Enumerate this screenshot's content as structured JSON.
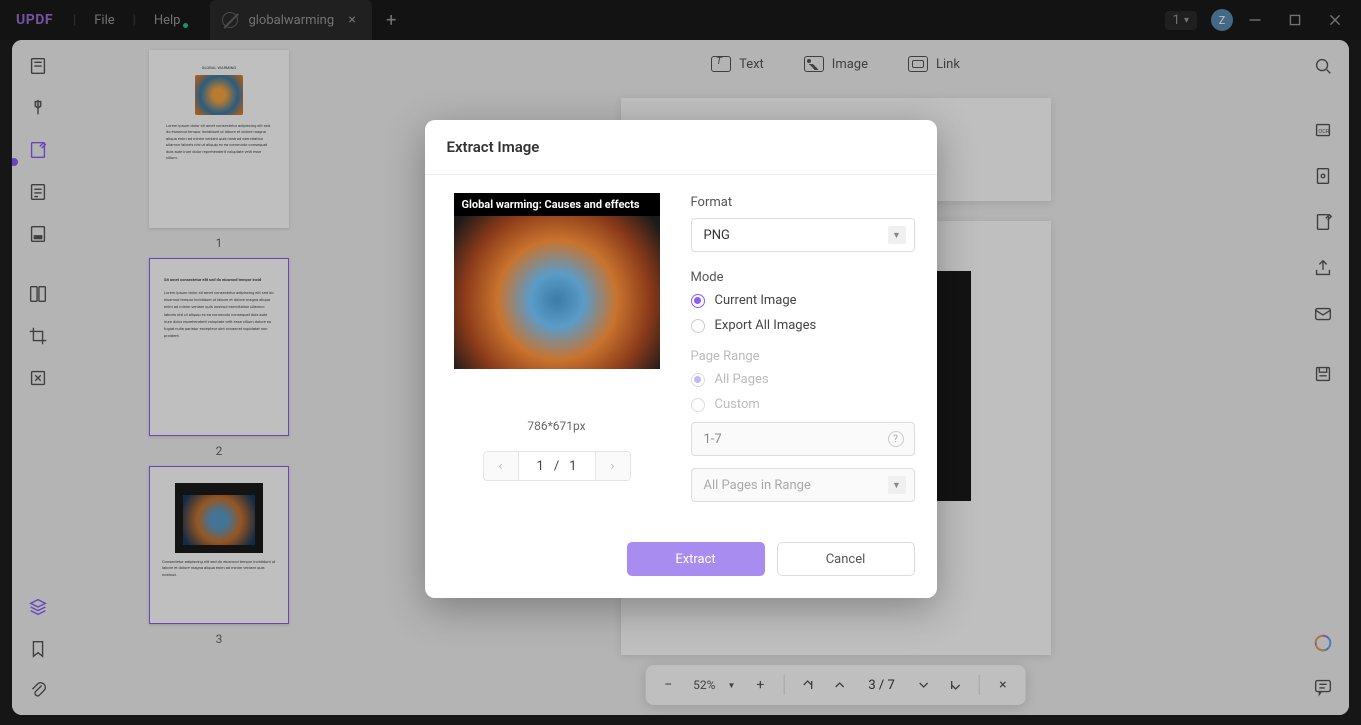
{
  "titlebar": {
    "logo": "UPDF",
    "menu_file": "File",
    "menu_help": "Help",
    "tab_title": "globalwarming",
    "user_count": "1",
    "user_initial": "Z"
  },
  "top_tools": {
    "text": "Text",
    "image": "Image",
    "link": "Link"
  },
  "thumbnails": {
    "p1": "1",
    "p2": "2",
    "p3": "3"
  },
  "bottom_bar": {
    "zoom": "52%",
    "page_current": "3",
    "page_sep": "/",
    "page_total": "7"
  },
  "modal": {
    "title": "Extract Image",
    "preview_title": "Global warming: Causes and effects",
    "dimensions": "786*671px",
    "pager_current": "1",
    "pager_sep": "/",
    "pager_total": "1",
    "format_label": "Format",
    "format_value": "PNG",
    "mode_label": "Mode",
    "mode_current": "Current Image",
    "mode_all": "Export All Images",
    "range_label": "Page Range",
    "range_all": "All Pages",
    "range_custom": "Custom",
    "range_value": "1-7",
    "range_scope": "All Pages in Range",
    "btn_extract": "Extract",
    "btn_cancel": "Cancel"
  },
  "page_content": {
    "img_caption": "Global warming: Causes and effects"
  }
}
